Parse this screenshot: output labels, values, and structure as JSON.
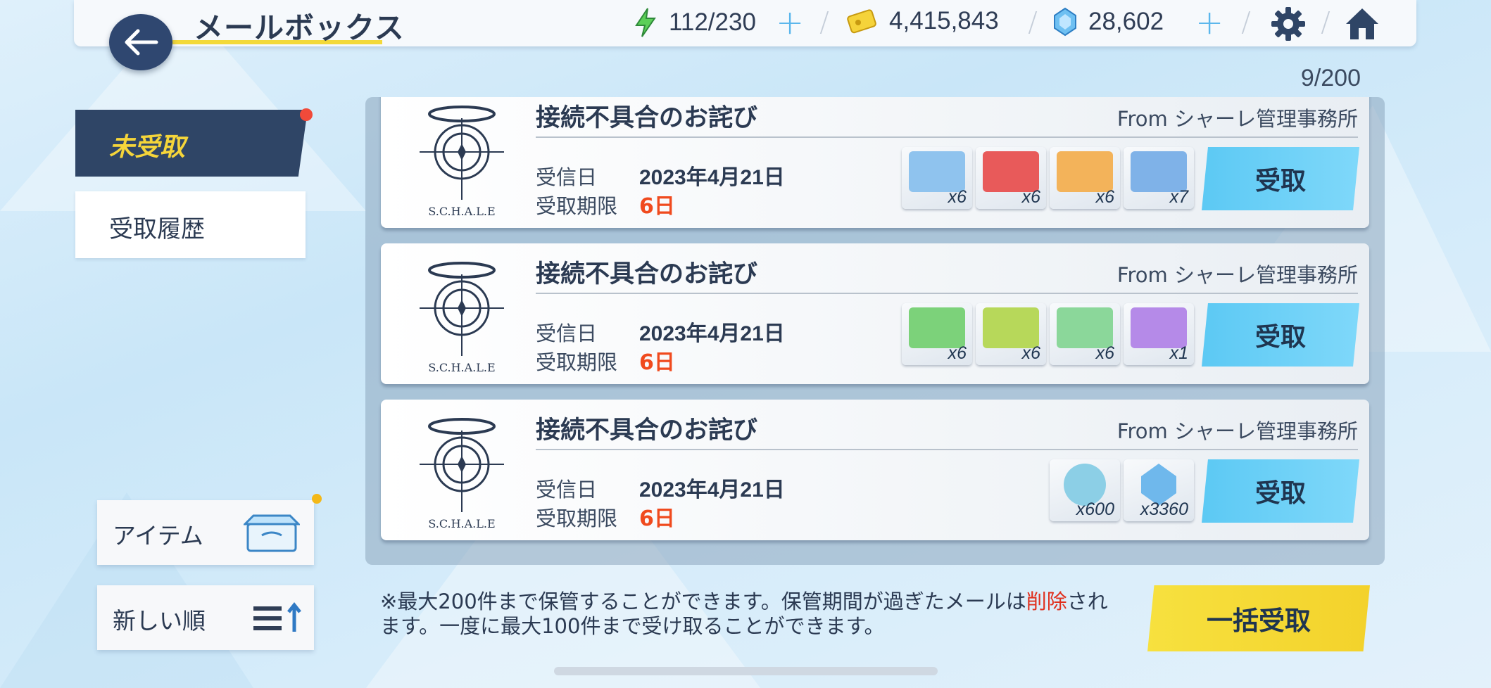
{
  "header": {
    "title": "メールボックス",
    "ap": "112/230",
    "credits": "4,415,843",
    "gems": "28,602"
  },
  "counter": "9/200",
  "tabs": {
    "unclaimed": "未受取",
    "history": "受取履歴"
  },
  "side": {
    "items_label": "アイテム",
    "sort_label": "新しい順"
  },
  "mails": [
    {
      "subject": "接続不具合のお詫び",
      "from": "From シャーレ管理事務所",
      "received_label": "受信日",
      "received_date": "2023年4月21日",
      "deadline_label": "受取期限",
      "deadline": "6日",
      "claim_label": "受取",
      "items": [
        {
          "icon": "ticket-blue-icon",
          "qty": "x6",
          "color": "#8fc3ee"
        },
        {
          "icon": "ticket-red-icon",
          "qty": "x6",
          "color": "#e85a5a"
        },
        {
          "icon": "ticket-orange-icon",
          "qty": "x6",
          "color": "#f3b35a"
        },
        {
          "icon": "ticket-blue2-icon",
          "qty": "x7",
          "color": "#7fb2e8"
        }
      ]
    },
    {
      "subject": "接続不具合のお詫び",
      "from": "From シャーレ管理事務所",
      "received_label": "受信日",
      "received_date": "2023年4月21日",
      "deadline_label": "受取期限",
      "deadline": "6日",
      "claim_label": "受取",
      "items": [
        {
          "icon": "ticket-green-icon",
          "qty": "x6",
          "color": "#7cd27a"
        },
        {
          "icon": "ticket-lime-icon",
          "qty": "x6",
          "color": "#b7d85a"
        },
        {
          "icon": "ticket-mint-icon",
          "qty": "x6",
          "color": "#8bd79a"
        },
        {
          "icon": "ticket-purple-icon",
          "qty": "x1",
          "color": "#b58ae8"
        }
      ]
    },
    {
      "subject": "接続不具合のお詫び",
      "from": "From シャーレ管理事務所",
      "received_label": "受信日",
      "received_date": "2023年4月21日",
      "deadline_label": "受取期限",
      "deadline": "6日",
      "claim_label": "受取",
      "items": [
        {
          "icon": "activity-report-icon",
          "qty": "x600",
          "color": "#8ccfe6"
        },
        {
          "icon": "pyroxene-icon",
          "qty": "x3360",
          "color": "#6fb8ec"
        }
      ]
    }
  ],
  "notice": {
    "part1": "※最大200件まで保管することができます。保管期間が過ぎたメールは",
    "deleted": "削除",
    "part2": "されます。一度に最大100件まで受け取ることができます。"
  },
  "bulk_claim_label": "一括受取"
}
